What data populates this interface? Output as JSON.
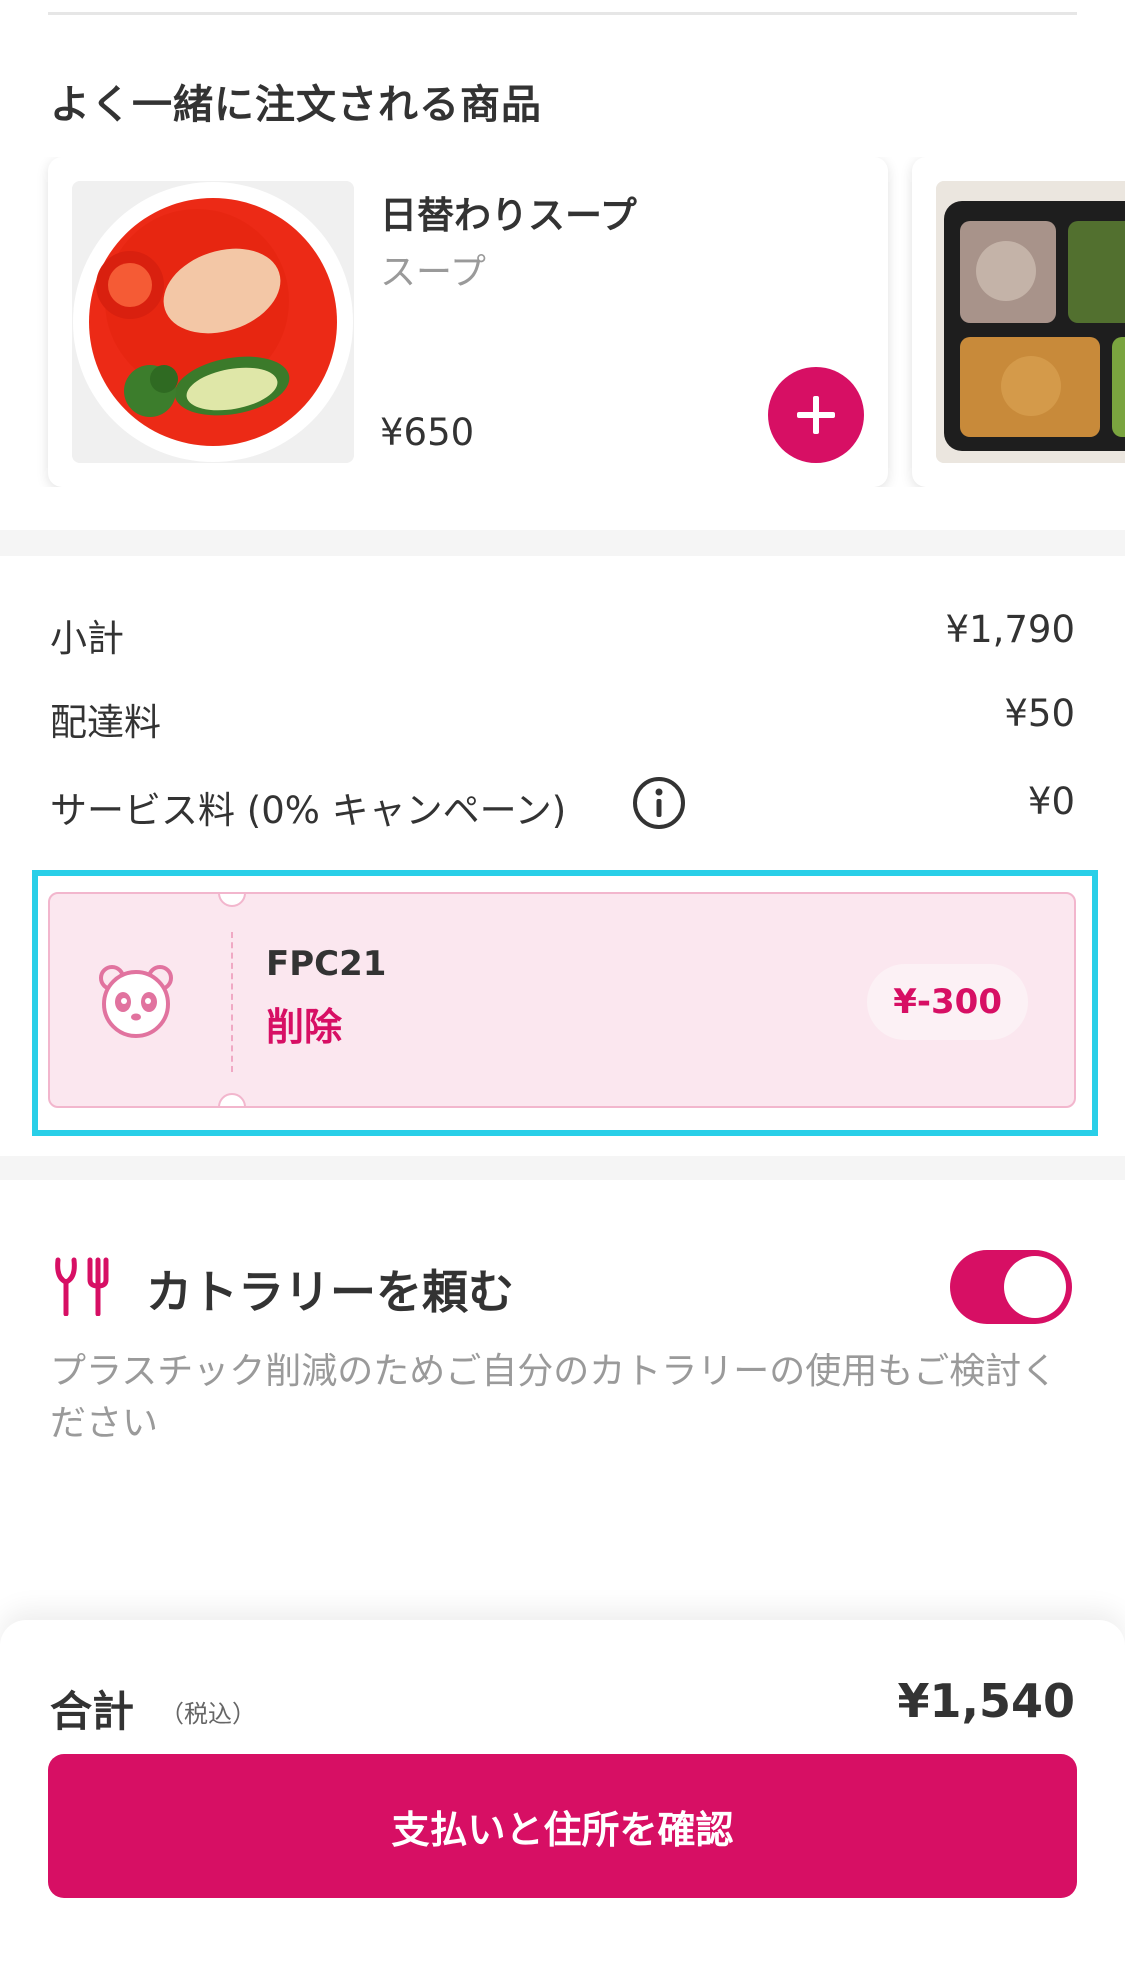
{
  "colors": {
    "brand": "#d70f64",
    "highlight": "#29cfe8",
    "voucher_bg": "#fbe7ef"
  },
  "recommendations": {
    "title": "よく一緒に注文される商品",
    "items": [
      {
        "name": "日替わりスープ",
        "category": "スープ",
        "price": "¥650",
        "add_icon": "plus-icon"
      }
    ]
  },
  "summary": {
    "rows": [
      {
        "label": "小計",
        "value": "¥1,790"
      },
      {
        "label": "配達料",
        "value": "¥50"
      },
      {
        "label": "サービス料 (0% キャンペーン)",
        "value": "¥0",
        "icon": "info-icon"
      }
    ]
  },
  "voucher": {
    "icon": "panda-icon",
    "code": "FPC21",
    "remove_label": "削除",
    "discount": "¥-300"
  },
  "cutlery": {
    "icon": "cutlery-icon",
    "title": "カトラリーを頼む",
    "enabled": true,
    "note": "プラスチック削減のためご自分のカトラリーの使用もご検討ください"
  },
  "footer": {
    "total_label": "合計",
    "tax_note": "（税込）",
    "total_value": "¥1,540",
    "checkout_label": "支払いと住所を確認"
  }
}
